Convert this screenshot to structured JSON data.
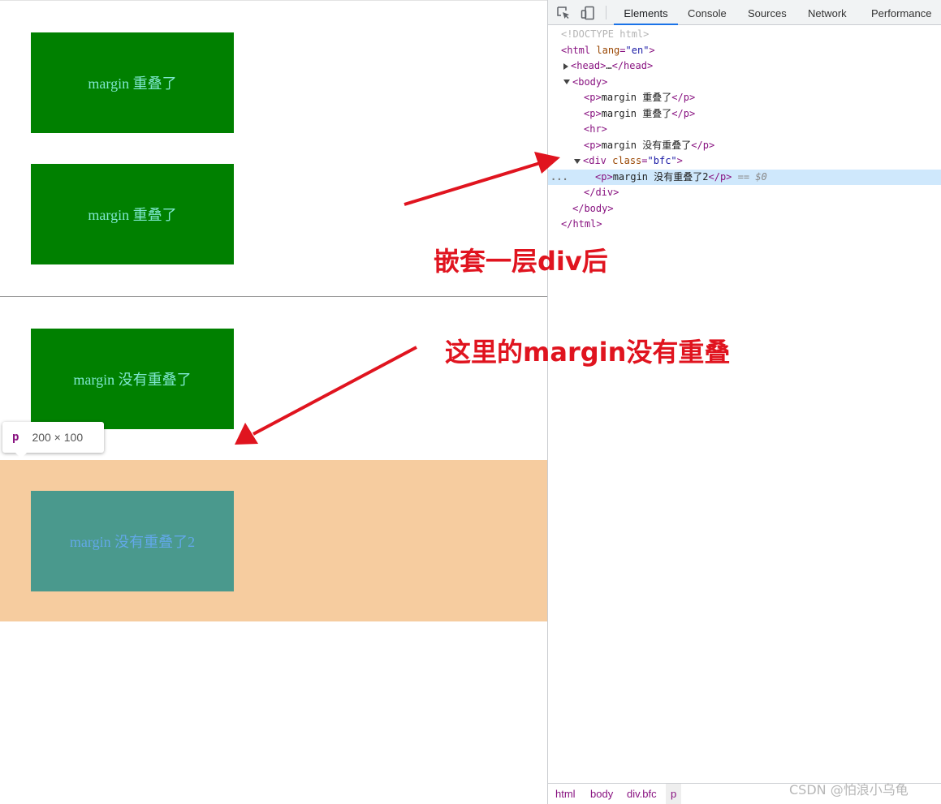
{
  "preview": {
    "box1_text": "margin 重叠了",
    "box2_text": "margin 重叠了",
    "box3_text": "margin 没有重叠了",
    "box4_text": "margin 没有重叠了2",
    "colors": {
      "box": "#008000",
      "box_text": "#7fe7cf",
      "bfc_bg": "#f6cc9f",
      "bfc_box": "#4a998d",
      "bfc_box_text": "#62a8e8"
    }
  },
  "tooltip": {
    "tag": "p",
    "size": "200 × 100"
  },
  "devtools": {
    "toolbar": {
      "icons": [
        "inspect-icon",
        "device-toggle-icon"
      ],
      "tabs": [
        "Elements",
        "Console",
        "Sources",
        "Network",
        "Performance"
      ],
      "active_tab": "Elements"
    },
    "dom": {
      "doctype": "<!DOCTYPE html>",
      "html_open_tag": "html",
      "html_attr": "lang",
      "html_attr_val": "\"en\"",
      "head_open": "<head>",
      "head_ellipsis": "…",
      "head_close": "</head>",
      "body_open": "<body>",
      "p_open": "<p>",
      "p_close": "</p>",
      "p1_text": "margin 重叠了",
      "p2_text": "margin 重叠了",
      "hr": "<hr>",
      "p3_text": "margin 没有重叠了",
      "div_tag": "div",
      "div_attr": "class",
      "div_attr_val": "\"bfc\"",
      "p4_text": "margin 没有重叠了2",
      "selected_marker": "== $0",
      "ellipsis": "...",
      "div_close": "</div>",
      "body_close": "</body>",
      "html_close": "</html>"
    },
    "breadcrumb": [
      "html",
      "body",
      "div.bfc",
      "p"
    ]
  },
  "annotations": {
    "label1": "嵌套一层div后",
    "label2": "这里的margin没有重叠",
    "color": "#e0141f"
  },
  "watermark": "CSDN @怕浪小乌龟"
}
